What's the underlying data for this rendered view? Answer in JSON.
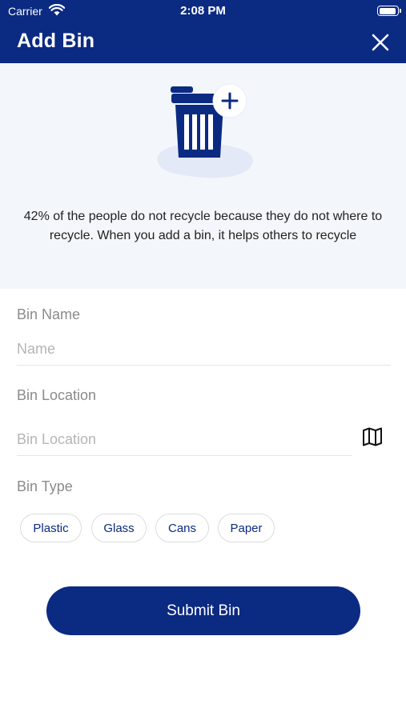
{
  "status_bar": {
    "carrier": "Carrier",
    "time": "2:08 PM",
    "battery_level": 0.95
  },
  "header": {
    "title": "Add Bin",
    "close_icon": "close-icon"
  },
  "hero": {
    "illustration_icon": "trash-bin-add-icon",
    "message": "42% of the people do not recycle because they do not where to recycle. When you add a bin, it helps others to recycle"
  },
  "form": {
    "bin_name": {
      "label": "Bin Name",
      "placeholder": "Name",
      "value": ""
    },
    "bin_location": {
      "label": "Bin Location",
      "placeholder": "Bin Location",
      "value": "",
      "map_icon": "map-icon"
    },
    "bin_type": {
      "label": "Bin Type",
      "options": [
        "Plastic",
        "Glass",
        "Cans",
        "Paper"
      ]
    }
  },
  "submit_label": "Submit Bin",
  "colors": {
    "primary": "#0b2a82",
    "hero_bg": "#f3f7fc",
    "chip_border": "#dcdcdc"
  }
}
